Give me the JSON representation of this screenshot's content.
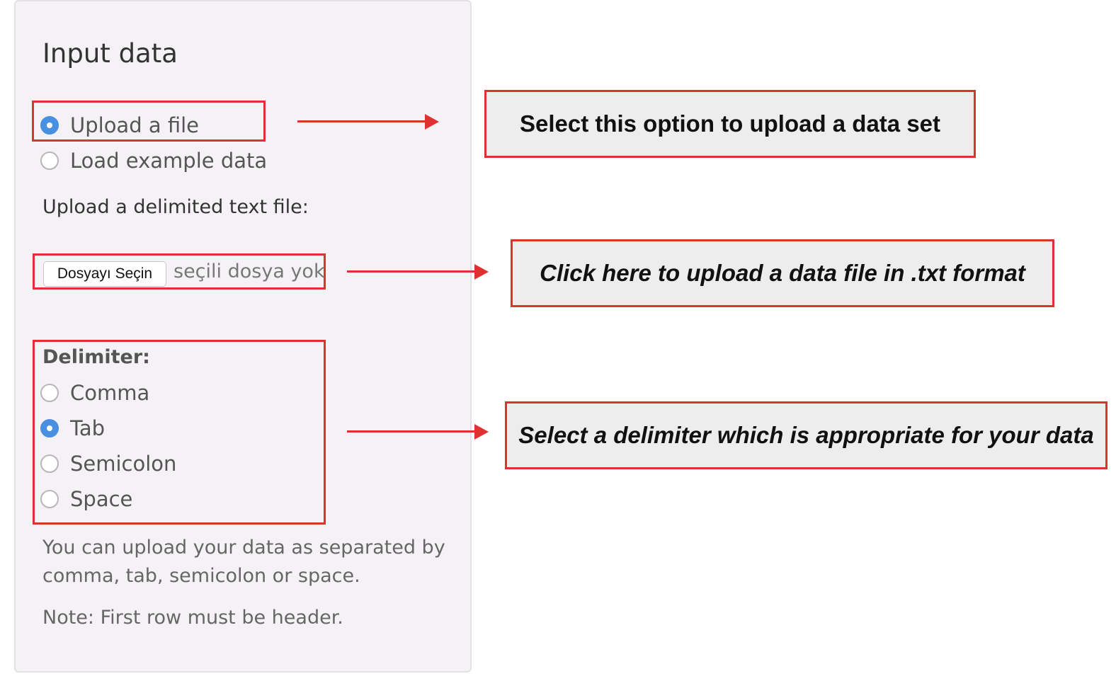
{
  "panel": {
    "title": "Input data",
    "source_options": [
      {
        "label": "Upload a file",
        "selected": true
      },
      {
        "label": "Load example data",
        "selected": false
      }
    ],
    "file_label": "Upload a delimited text file:",
    "file_button_label": "Dosyayı Seçin",
    "file_status": "seçili dosya yok",
    "delimiter_label": "Delimiter:",
    "delimiter_options": [
      {
        "label": "Comma",
        "selected": false
      },
      {
        "label": "Tab",
        "selected": true
      },
      {
        "label": "Semicolon",
        "selected": false
      },
      {
        "label": "Space",
        "selected": false
      }
    ],
    "help_line1": "You can upload your data as separated by",
    "help_line2": "comma, tab, semicolon or space.",
    "note": "Note: First row must be header."
  },
  "annotations": {
    "callout1": "Select this option to upload a data set",
    "callout2": "Click here to upload a data file in .txt format",
    "callout3": "Select a delimiter which is appropriate for your data"
  },
  "colors": {
    "accent": "#4a90e2",
    "annotation_red": "#e03131",
    "panel_bg": "#f5f2f5",
    "callout_bg": "#ededed"
  }
}
